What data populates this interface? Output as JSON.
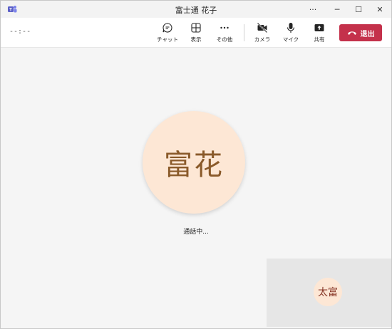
{
  "window": {
    "title": "富士通 花子",
    "more_label": "···",
    "minimize_label": "─",
    "maximize_label": "☐",
    "close_label": "✕"
  },
  "toolbar": {
    "timer": "--:--",
    "chat_label": "チャット",
    "view_label": "表示",
    "more_label": "その他",
    "camera_label": "カメラ",
    "mic_label": "マイク",
    "share_label": "共有",
    "leave_label": "退出"
  },
  "stage": {
    "remote_initials": "富花",
    "status": "通話中...",
    "self_initials": "太富"
  },
  "colors": {
    "leave": "#c4314b",
    "avatar_bg": "#fde7d5",
    "avatar_text": "#8a5a2a",
    "teams_purple": "#5b5fc7"
  }
}
